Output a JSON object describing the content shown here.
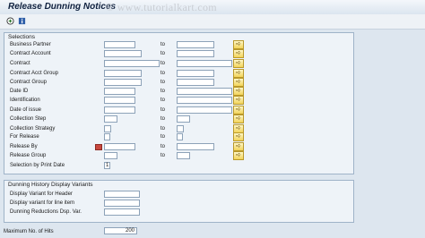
{
  "window": {
    "title": "Release Dunning Notices",
    "watermark": "© www.tutorialkart.com"
  },
  "toolbar": {
    "icons": [
      "execute-icon",
      "info-icon"
    ],
    "execute_glyph": "⊕",
    "info_glyph": "i"
  },
  "selections": {
    "title": "Selections",
    "to_label": "to",
    "more_glyph": "➪",
    "rows": [
      {
        "label": "Business Partner",
        "from": "",
        "to": ""
      },
      {
        "label": "Contract Account",
        "from": "",
        "to": ""
      },
      {
        "label": "Contract",
        "from": "",
        "to": ""
      },
      {
        "label": "Contract Acct Group",
        "from": "",
        "to": ""
      },
      {
        "label": "Contract Group",
        "from": "",
        "to": ""
      },
      {
        "label": "Date ID",
        "from": "",
        "to": ""
      },
      {
        "label": "Identification",
        "from": "",
        "to": ""
      },
      {
        "label": "Date of issue",
        "from": "",
        "to": ""
      },
      {
        "label": "Collection Step",
        "from": "",
        "to": ""
      },
      {
        "label": "Collection Strategy",
        "from": "",
        "to": ""
      },
      {
        "label": "For Release",
        "from": "",
        "to": ""
      },
      {
        "label": "Release By",
        "from": "",
        "to": ""
      },
      {
        "label": "Release Group",
        "from": "",
        "to": ""
      }
    ],
    "print_date_label": "Selection by Print Date",
    "print_date_value": "1"
  },
  "display_variants": {
    "title": "Dunning History Display Variants",
    "rows": [
      {
        "label": "Display Variant for Header",
        "value": ""
      },
      {
        "label": "Display variant for line item",
        "value": ""
      },
      {
        "label": "Dunning Reductions Dsp. Var.",
        "value": ""
      }
    ]
  },
  "max_hits": {
    "label": "Maximum No. of Hits",
    "value": "200"
  },
  "colors": {
    "background": "#dde6ef",
    "group_border": "#9fb3c8",
    "more_button": "#f2d45a",
    "required_marker": "#c8473e"
  }
}
